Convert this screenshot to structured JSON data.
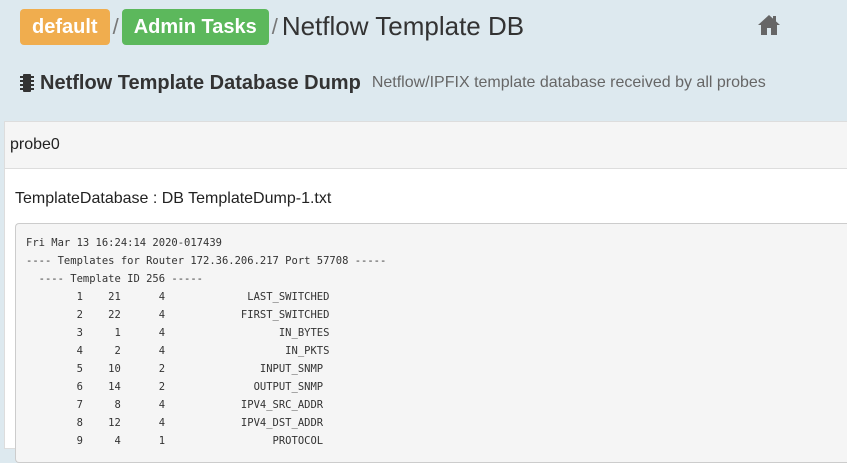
{
  "breadcrumb": {
    "items": [
      "default",
      "Admin Tasks"
    ],
    "separator": "/",
    "title": "Netflow Template DB"
  },
  "icons": {
    "home": "home-icon",
    "chip": "chip-icon"
  },
  "subtitle": {
    "main": "Netflow Template Database Dump",
    "description": "Netflow/IPFIX template database received by all probes"
  },
  "panel": {
    "heading": "probe0",
    "section_title": "TemplateDatabase : DB TemplateDump-1.txt",
    "dump_lines": [
      "Fri Mar 13 16:24:14 2020-017439",
      "---- Templates for Router 172.36.206.217 Port 57708 -----",
      "  ---- Template ID 256 -----",
      "        1    21      4             LAST_SWITCHED",
      "        2    22      4            FIRST_SWITCHED",
      "        3     1      4                  IN_BYTES",
      "        4     2      4                   IN_PKTS",
      "        5    10      2               INPUT_SNMP",
      "        6    14      2              OUTPUT_SNMP",
      "        7     8      4            IPV4_SRC_ADDR",
      "        8    12      4            IPV4_DST_ADDR",
      "        9     4      1                 PROTOCOL"
    ]
  },
  "colors": {
    "header_bg": "#dde9ef",
    "badge_default": "#f0ad4e",
    "badge_admin": "#5cb85c"
  }
}
